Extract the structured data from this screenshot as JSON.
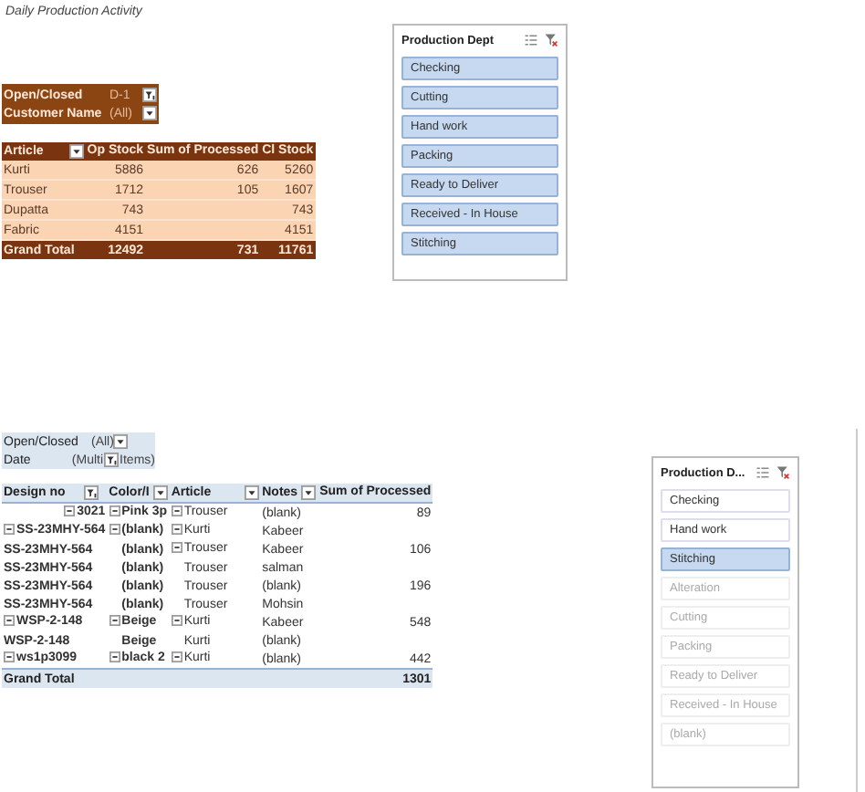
{
  "title": "Daily Production Activity",
  "pivot_1": {
    "filters": [
      {
        "label": "Open/Closed",
        "value": "D-1",
        "kind": "filter"
      },
      {
        "label": "Customer Name",
        "value": "(All)",
        "kind": "dropdown"
      }
    ],
    "columns": [
      {
        "label": "Article",
        "kind": "dropdown"
      },
      {
        "label": "Op Stock"
      },
      {
        "label": "Sum of Processed"
      },
      {
        "label": "Cl Stock"
      }
    ],
    "rows": [
      {
        "article": "Kurti",
        "op_stock": "5886",
        "processed": "626",
        "cl_stock": "5260"
      },
      {
        "article": "Trouser",
        "op_stock": "1712",
        "processed": "105",
        "cl_stock": "1607"
      },
      {
        "article": "Dupatta",
        "op_stock": "743",
        "processed": "",
        "cl_stock": "743"
      },
      {
        "article": "Fabric",
        "op_stock": "4151",
        "processed": "",
        "cl_stock": "4151"
      }
    ],
    "total": {
      "label": "Grand Total",
      "op_stock": "12492",
      "processed": "731",
      "cl_stock": "11761"
    }
  },
  "slicer_1": {
    "title": "Production Dept",
    "items": [
      {
        "label": "Checking",
        "selected": true,
        "has_data": true
      },
      {
        "label": "Cutting",
        "selected": true,
        "has_data": true
      },
      {
        "label": "Hand work",
        "selected": true,
        "has_data": true
      },
      {
        "label": "Packing",
        "selected": true,
        "has_data": true
      },
      {
        "label": "Ready to Deliver",
        "selected": true,
        "has_data": true
      },
      {
        "label": "Received - In House",
        "selected": true,
        "has_data": true
      },
      {
        "label": "Stitching",
        "selected": true,
        "has_data": true
      }
    ]
  },
  "pivot_2": {
    "filters": [
      {
        "label": "Open/Closed",
        "value": "(All)",
        "kind": "dropdown"
      },
      {
        "label": "Date",
        "value": "(Multi",
        "kind": "filter",
        "after": "Items)"
      }
    ],
    "columns": [
      {
        "label": "Design no",
        "kind": "filter"
      },
      {
        "label": "Color/I",
        "kind": "dropdown"
      },
      {
        "label": "Article",
        "kind": "dropdown"
      },
      {
        "label": "Notes",
        "kind": "dropdown"
      },
      {
        "label": "Sum of Processed"
      }
    ],
    "rows": [
      {
        "design": "3021",
        "design_toggle": true,
        "color_name": "Pink 3p",
        "color_toggle": true,
        "article": "Trouser",
        "article_toggle": true,
        "notes": "(blank)",
        "processed": "89"
      },
      {
        "design": "SS-23MHY-564",
        "design_toggle": true,
        "color_name": "(blank)",
        "color_toggle": true,
        "article": "Kurti",
        "article_toggle": true,
        "notes": "Kabeer",
        "processed": ""
      },
      {
        "design": "SS-23MHY-564",
        "design_toggle": false,
        "color_name": "(blank)",
        "color_toggle": false,
        "article": "Trouser",
        "article_toggle": true,
        "notes": "Kabeer",
        "processed": "106"
      },
      {
        "design": "SS-23MHY-564",
        "design_toggle": false,
        "color_name": "(blank)",
        "color_toggle": false,
        "article": "Trouser",
        "article_toggle": false,
        "notes": "salman",
        "processed": ""
      },
      {
        "design": "SS-23MHY-564",
        "design_toggle": false,
        "color_name": "(blank)",
        "color_toggle": false,
        "article": "Trouser",
        "article_toggle": false,
        "notes": "(blank)",
        "processed": "196"
      },
      {
        "design": "SS-23MHY-564",
        "design_toggle": false,
        "color_name": "(blank)",
        "color_toggle": false,
        "article": "Trouser",
        "article_toggle": false,
        "notes": "Mohsin",
        "processed": ""
      },
      {
        "design": "WSP-2-148",
        "design_toggle": true,
        "color_name": "Beige",
        "color_toggle": true,
        "article": "Kurti",
        "article_toggle": true,
        "notes": "Kabeer",
        "processed": "548"
      },
      {
        "design": "WSP-2-148",
        "design_toggle": false,
        "color_name": "Beige",
        "color_toggle": false,
        "article": "Kurti",
        "article_toggle": false,
        "notes": "(blank)",
        "processed": ""
      },
      {
        "design": "ws1p3099",
        "design_toggle": true,
        "color_name": "black 2",
        "color_toggle": true,
        "article": "Kurti",
        "article_toggle": true,
        "notes": "(blank)",
        "processed": "442"
      }
    ],
    "total": {
      "label": "Grand Total",
      "processed": "1301"
    }
  },
  "slicer_2": {
    "title": "Production D...",
    "items": [
      {
        "label": "Checking",
        "selected": false,
        "has_data": true
      },
      {
        "label": "Hand work",
        "selected": false,
        "has_data": true
      },
      {
        "label": "Stitching",
        "selected": true,
        "has_data": true
      },
      {
        "label": "Alteration",
        "selected": false,
        "has_data": false
      },
      {
        "label": "Cutting",
        "selected": false,
        "has_data": false
      },
      {
        "label": "Packing",
        "selected": false,
        "has_data": false
      },
      {
        "label": "Ready to Deliver",
        "selected": false,
        "has_data": false
      },
      {
        "label": "Received - In House",
        "selected": false,
        "has_data": false
      },
      {
        "label": "(blank)",
        "selected": false,
        "has_data": false
      }
    ]
  }
}
